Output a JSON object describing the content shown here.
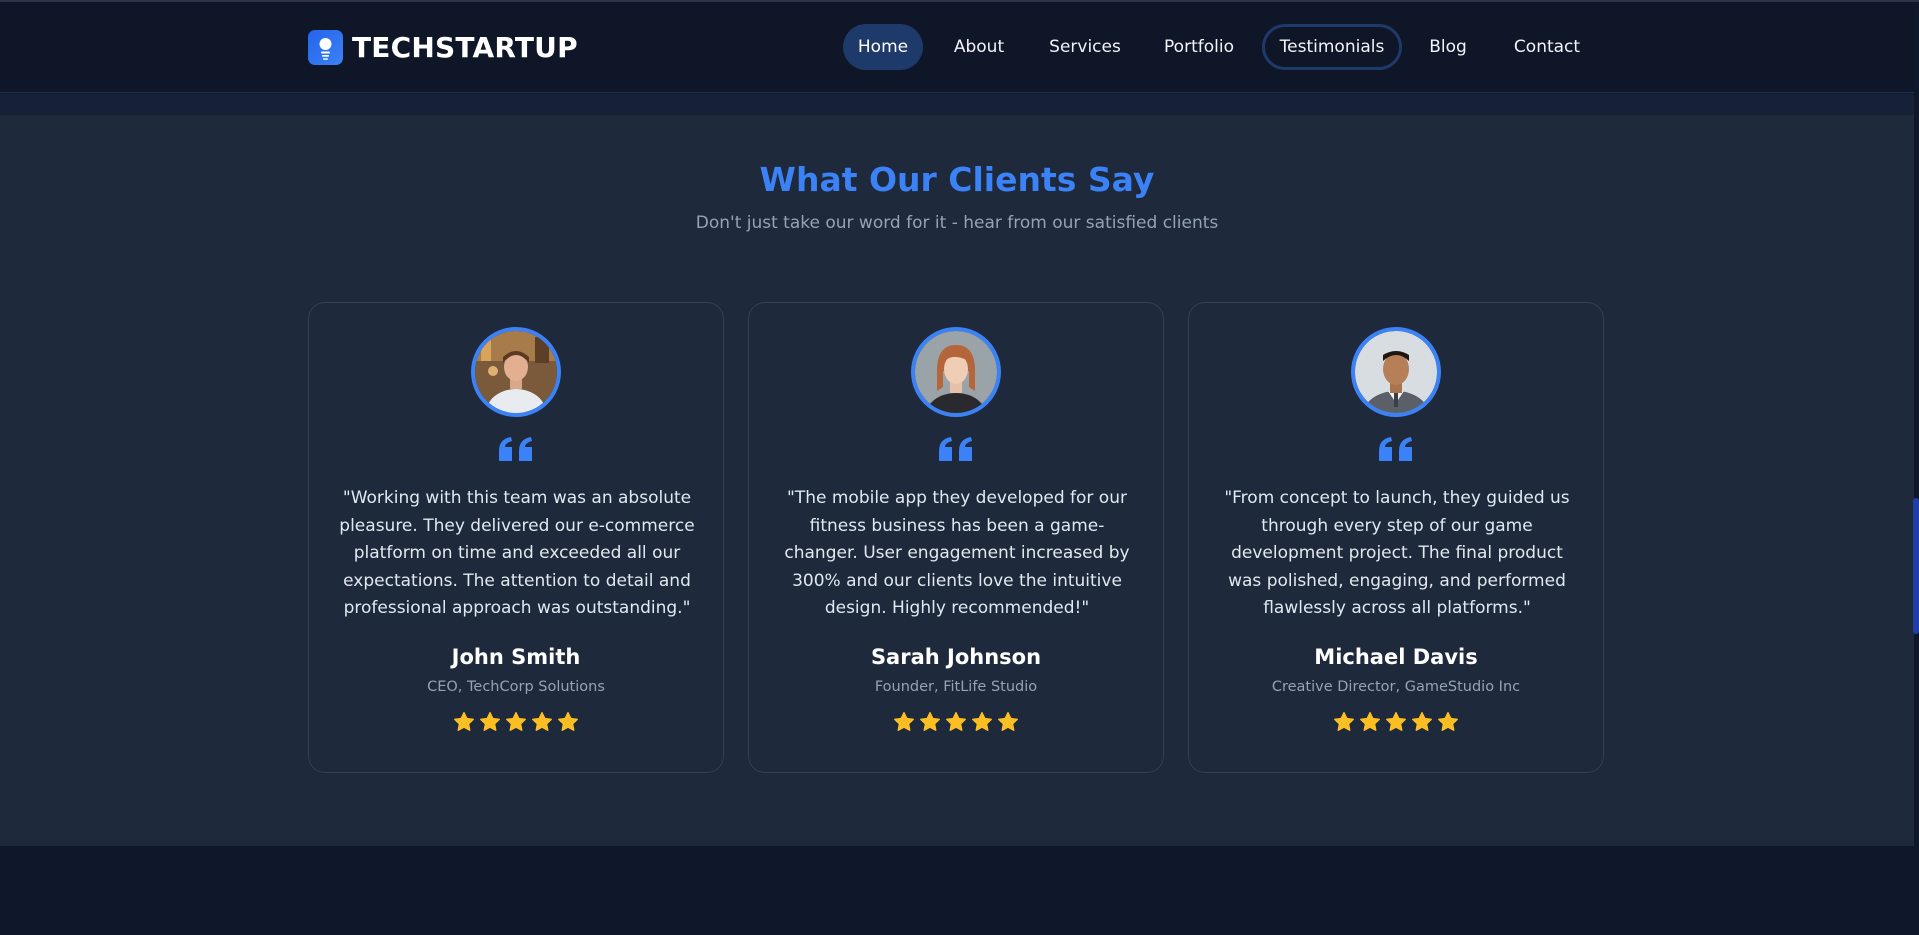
{
  "brand": {
    "name": "TECHSTARTUP",
    "icon": "lightbulb-icon"
  },
  "nav": {
    "items": [
      {
        "label": "Home",
        "state": "active"
      },
      {
        "label": "About"
      },
      {
        "label": "Services"
      },
      {
        "label": "Portfolio"
      },
      {
        "label": "Testimonials",
        "state": "focused"
      },
      {
        "label": "Blog"
      },
      {
        "label": "Contact"
      }
    ]
  },
  "testimonials": {
    "title": "What Our Clients Say",
    "subtitle": "Don't just take our word for it - hear from our satisfied clients",
    "cards": [
      {
        "quote": "\"Working with this team was an absolute pleasure. They delivered our e-commerce platform on time and exceeded all our expectations. The attention to detail and professional approach was outstanding.\"",
        "name": "John Smith",
        "role": "CEO, TechCorp Solutions",
        "rating": 5
      },
      {
        "quote": "\"The mobile app they developed for our fitness business has been a game-changer. User engagement increased by 300% and our clients love the intuitive design. Highly recommended!\"",
        "name": "Sarah Johnson",
        "role": "Founder, FitLife Studio",
        "rating": 5
      },
      {
        "quote": "\"From concept to launch, they guided us through every step of our game development project. The final product was polished, engaging, and performed flawlessly across all platforms.\"",
        "name": "Michael Davis",
        "role": "Creative Director, GameStudio Inc",
        "rating": 5
      }
    ]
  },
  "colors": {
    "accent": "#3b82f6",
    "star": "#fbbf24",
    "background": "#0f172a",
    "section": "#1e293b"
  }
}
